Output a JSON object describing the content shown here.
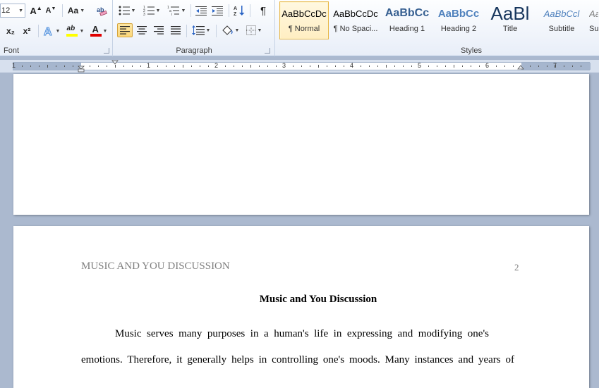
{
  "ribbon": {
    "font": {
      "group_label": "Font",
      "font_size": "12",
      "grow_label": "A",
      "shrink_label": "A",
      "case_label": "Aa",
      "subscript_label": "x₂",
      "superscript_label": "x²",
      "highlight_label": "ab",
      "font_color_label": "A",
      "colors": {
        "highlight": "#ffff00",
        "font_color": "#e00000",
        "effects": "#4f8fdc"
      }
    },
    "paragraph": {
      "group_label": "Paragraph",
      "active_alignment": "align-left"
    },
    "styles": {
      "group_label": "Styles",
      "items": [
        {
          "preview": "AaBbCcDc",
          "name": "¶ Normal",
          "selected": true
        },
        {
          "preview": "AaBbCcDc",
          "name": "¶ No Spaci...",
          "selected": false
        },
        {
          "preview": "AaBbCc",
          "name": "Heading 1",
          "selected": false
        },
        {
          "preview": "AaBbCc",
          "name": "Heading 2",
          "selected": false
        },
        {
          "preview": "AaBl",
          "name": "Title",
          "selected": false
        },
        {
          "preview": "AaBbCcl",
          "name": "Subtitle",
          "selected": false
        },
        {
          "preview": "Aa",
          "name": "Sul",
          "selected": false
        }
      ]
    }
  },
  "ruler": {
    "numbers": [
      "1",
      "1",
      "2",
      "3",
      "4",
      "5",
      "6",
      "7"
    ]
  },
  "document": {
    "running_head": "MUSIC AND YOU DISCUSSION",
    "page_number": "2",
    "title": "Music and You Discussion",
    "lines": [
      "Music serves many purposes in a human's life in expressing and modifying one's",
      "emotions. Therefore, it generally helps in controlling one's moods. Many instances and years of"
    ]
  }
}
